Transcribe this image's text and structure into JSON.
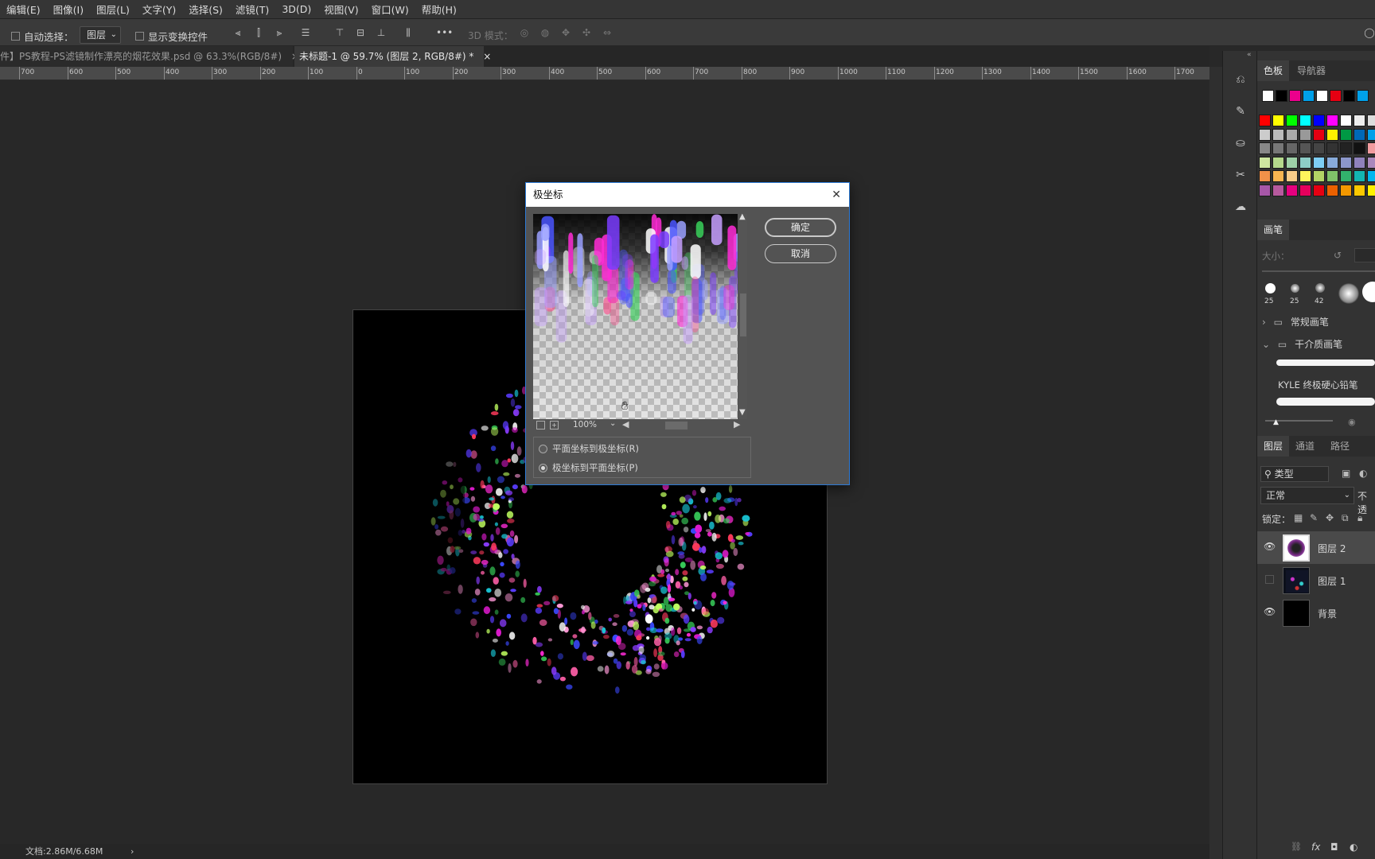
{
  "menubar": {
    "items": [
      "编辑(E)",
      "图像(I)",
      "图层(L)",
      "文字(Y)",
      "选择(S)",
      "滤镜(T)",
      "3D(D)",
      "视图(V)",
      "窗口(W)",
      "帮助(H)"
    ]
  },
  "options": {
    "auto_select_label": "自动选择：",
    "auto_select_value": "图层",
    "show_transform_label": "显示变换控件",
    "more": "•••",
    "mode_3d": "3D 模式："
  },
  "tabs": [
    {
      "label": "件】PS教程-PS滤镜制作漂亮的烟花效果.psd @ 63.3%(RGB/8#)",
      "close": "×"
    },
    {
      "label": "未标题-1 @ 59.7% (图层 2, RGB/8#) *",
      "close": "×"
    }
  ],
  "ruler": {
    "ticks": [
      "700",
      "600",
      "500",
      "400",
      "300",
      "200",
      "100",
      "0",
      "100",
      "200",
      "300",
      "400",
      "500",
      "600",
      "700",
      "800",
      "900",
      "1000",
      "1100",
      "1200",
      "1300",
      "1400",
      "1500",
      "1600",
      "1700"
    ]
  },
  "dialog": {
    "title": "极坐标",
    "close": "✕",
    "ok": "确定",
    "cancel": "取消",
    "zoom": "100%",
    "option_rect_to_polar": "平面坐标到极坐标(R)",
    "option_polar_to_rect": "极坐标到平面坐标(P)",
    "selected_option": "polar_to_rect"
  },
  "panels": {
    "swatches_tab": "色板",
    "navigator_tab": "导航器",
    "brush_tab": "画笔",
    "brush_size_label": "大小：",
    "brush_sizes": [
      "25",
      "25",
      "42"
    ],
    "brush_group_1": "常规画笔",
    "brush_group_2": "干介质画笔",
    "brush_name": "KYLE 终极硬心铅笔",
    "layers_tab": "图层",
    "channels_tab": "通道",
    "paths_tab": "路径",
    "filter_kind": "类型",
    "blend_mode": "正常",
    "opacity_label": "不透",
    "lock_label": "锁定：",
    "layers": [
      {
        "name": "图层 2",
        "visible": true,
        "selected": true
      },
      {
        "name": "图层 1",
        "visible": false,
        "selected": false
      },
      {
        "name": "背景",
        "visible": true,
        "selected": false
      }
    ],
    "footer_fx": "fx"
  },
  "status": {
    "doc_info": "文档:2.86M/6.68M",
    "arrow": "›"
  },
  "colors": {
    "accent": "#2d7ad6",
    "swatches_row1": [
      "#ffffff",
      "#000000",
      "#ec008c",
      "#00a0e9",
      "#ffffff",
      "#e60012",
      "#000000",
      "#00a0e9"
    ],
    "swatches_grid": [
      [
        "#ff0000",
        "#ffff00",
        "#00ff00",
        "#00ffff",
        "#0000ff",
        "#ff00ff",
        "#ffffff",
        "#eeeeee",
        "#dddddd"
      ],
      [
        "#cccccc",
        "#bbbbbb",
        "#aaaaaa",
        "#999999",
        "#e60012",
        "#fff100",
        "#009944",
        "#0068b7",
        "#00a0e9"
      ],
      [
        "#888888",
        "#777777",
        "#666666",
        "#555555",
        "#444444",
        "#333333",
        "#222222",
        "#111111",
        "#f29c9f"
      ],
      [
        "#cde6a0",
        "#b5d98c",
        "#9ed1a7",
        "#8dcdc7",
        "#7ecef4",
        "#88abda",
        "#8c97cb",
        "#8f82bc",
        "#aa89bd"
      ],
      [
        "#f19149",
        "#f8b551",
        "#facd89",
        "#fff45c",
        "#b3d465",
        "#80c269",
        "#32b16c",
        "#13b5b1",
        "#00b7ee"
      ],
      [
        "#a757a8",
        "#b75a9e",
        "#e5007f",
        "#e6005c",
        "#e60012",
        "#eb6100",
        "#f39800",
        "#fcc800",
        "#fff100"
      ]
    ]
  }
}
